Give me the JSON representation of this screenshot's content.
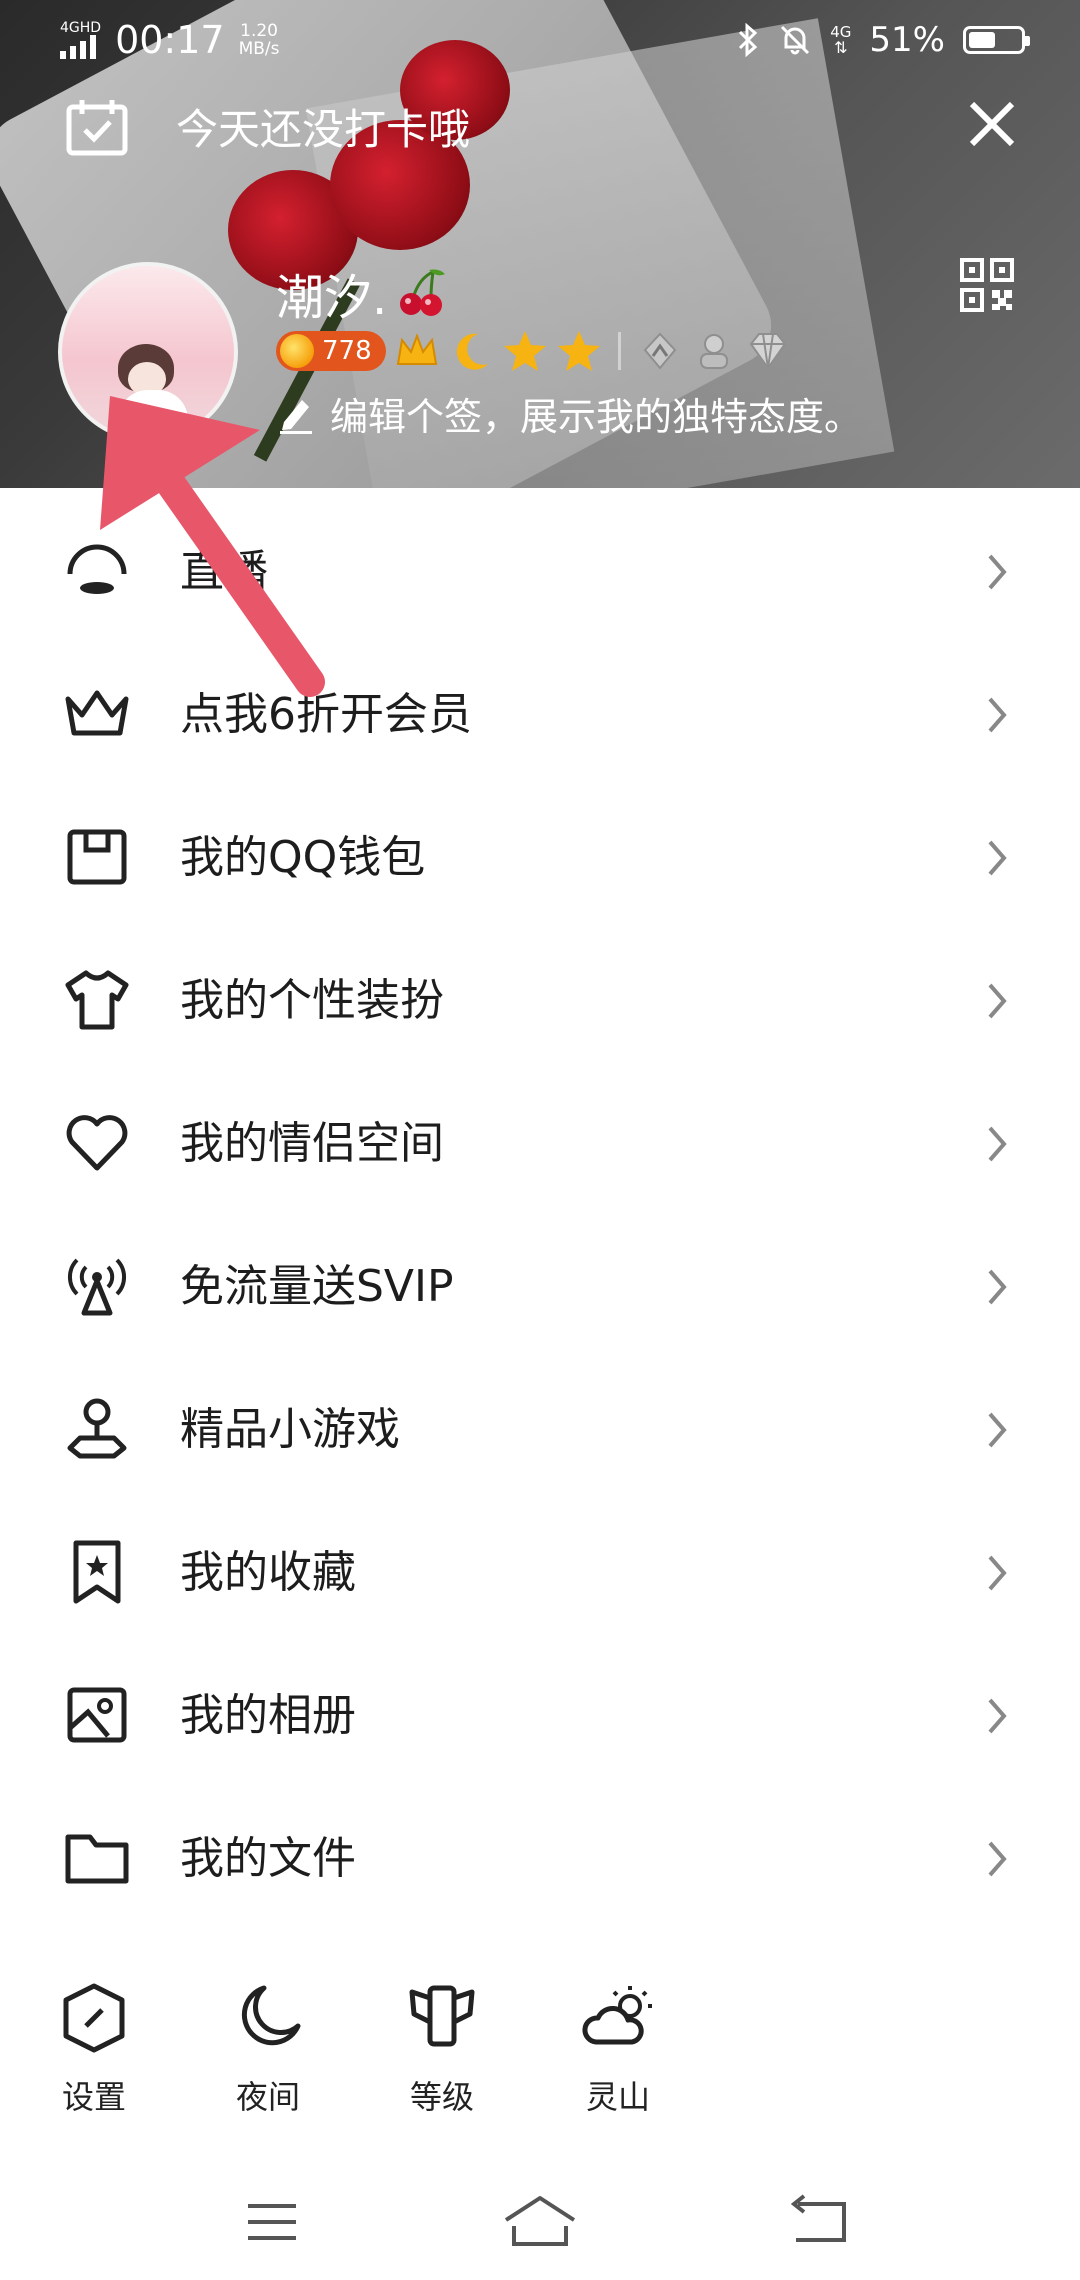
{
  "status_bar": {
    "network": "4GHD",
    "time": "00:17",
    "speed_value": "1.20",
    "speed_unit": "MB/s",
    "secondary_network": "4G",
    "battery": "51%",
    "battery_level": 0.51
  },
  "header": {
    "checkin_text": "今天还没打卡哦",
    "nickname": "潮汐.",
    "level_number": "778",
    "signature": "编辑个签，展示我的独特态度。"
  },
  "menu": [
    {
      "id": "live",
      "label": "直播",
      "icon": "live-icon"
    },
    {
      "id": "vip",
      "label": "点我6折开会员",
      "icon": "crown-icon"
    },
    {
      "id": "wallet",
      "label": "我的QQ钱包",
      "icon": "wallet-icon"
    },
    {
      "id": "dressup",
      "label": "我的个性装扮",
      "icon": "tshirt-icon"
    },
    {
      "id": "couple",
      "label": "我的情侣空间",
      "icon": "heart-icon"
    },
    {
      "id": "svip",
      "label": "免流量送SVIP",
      "icon": "signal-tower-icon"
    },
    {
      "id": "games",
      "label": "精品小游戏",
      "icon": "game-pin-icon"
    },
    {
      "id": "favorites",
      "label": "我的收藏",
      "icon": "bookmark-star-icon"
    },
    {
      "id": "album",
      "label": "我的相册",
      "icon": "photo-album-icon"
    },
    {
      "id": "files",
      "label": "我的文件",
      "icon": "folder-icon"
    }
  ],
  "toolbar": [
    {
      "id": "settings",
      "label": "设置",
      "icon": "settings-hexagon-icon"
    },
    {
      "id": "night",
      "label": "夜间",
      "icon": "moon-icon"
    },
    {
      "id": "level",
      "label": "等级",
      "icon": "level-wings-icon"
    },
    {
      "id": "lingshan",
      "label": "灵山",
      "icon": "weather-cloud-sun-icon"
    }
  ],
  "colors": {
    "annotation_arrow": "#e8566a",
    "level_pill": "#e2551d",
    "text": "#1d1d1d"
  }
}
